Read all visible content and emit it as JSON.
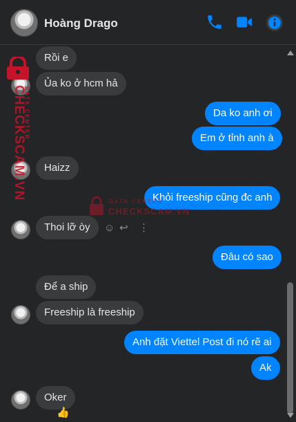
{
  "header": {
    "contact_name": "Hoàng Drago",
    "icons": [
      "phone-icon",
      "video-icon",
      "info-icon"
    ],
    "accent_color": "#0084ff"
  },
  "messages": [
    {
      "side": "in",
      "text": "Rồi e"
    },
    {
      "side": "in",
      "text": "Ủa ko ở hcm hả"
    },
    {
      "side": "out",
      "text": "Da ko anh ơi"
    },
    {
      "side": "out",
      "text": "Em ở tỉnh anh à"
    },
    {
      "side": "in",
      "text": "Haizz"
    },
    {
      "side": "out",
      "text": "Khỏi freeship cũng đc anh"
    },
    {
      "side": "in",
      "text": "Thoi lỡ òy"
    },
    {
      "side": "out",
      "text": "Đâu có sao"
    },
    {
      "side": "in",
      "text": "Để a ship"
    },
    {
      "side": "in",
      "text": "Freeship là freeship"
    },
    {
      "side": "out",
      "text": "Anh đặt Viettel Post đi nó rẽ ai"
    },
    {
      "side": "out",
      "text": "Ak"
    },
    {
      "side": "in",
      "text": "Oker"
    }
  ],
  "reaction": "👍",
  "watermark": {
    "side_big": "CHECKSCAM.VN",
    "side_small": "DATA CENTER",
    "center_small": "DATA CENTER",
    "center_big": "CHECKSCAM.VN"
  }
}
